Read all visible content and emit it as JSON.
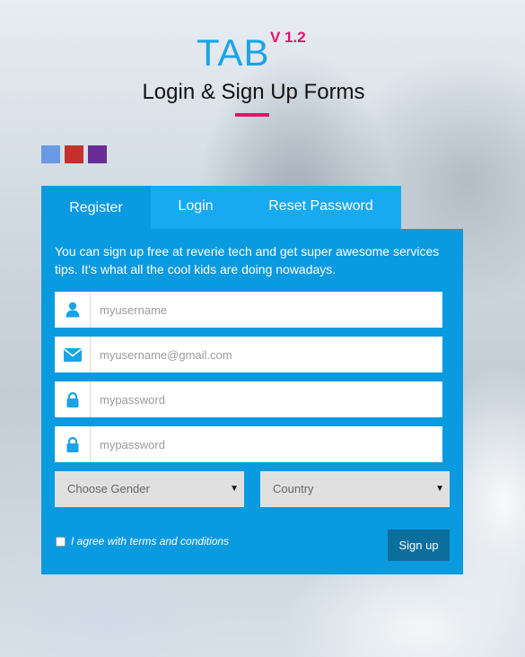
{
  "header": {
    "title": "TAB",
    "version": "V 1.2",
    "subtitle": "Login & Sign Up Forms"
  },
  "colors": {
    "accent": "#1aa3e8",
    "highlight": "#e6116b",
    "panel": "#0a9ae0",
    "tab_bar": "#17aaf0",
    "button": "#0b6e9c"
  },
  "swatches": [
    {
      "name": "blue",
      "color": "#6a9ae6"
    },
    {
      "name": "red",
      "color": "#c4302b"
    },
    {
      "name": "purple",
      "color": "#6a2c96"
    }
  ],
  "tabs": {
    "register": "Register",
    "login": "Login",
    "reset": "Reset Password",
    "active": "register"
  },
  "form": {
    "intro": "You can sign up free at reverie tech and get super awesome services tips. It's what all the cool kids are doing nowadays.",
    "username": {
      "placeholder": "myusername",
      "icon": "user-icon"
    },
    "email": {
      "placeholder": "myusername@gmail.com",
      "icon": "envelope-icon"
    },
    "password": {
      "placeholder": "mypassword",
      "icon": "lock-icon"
    },
    "confirm_password": {
      "placeholder": "mypassword",
      "icon": "lock-icon"
    },
    "gender": {
      "selected": "Choose Gender"
    },
    "country": {
      "selected": "Country"
    },
    "agree_label": "I agree with terms and conditions",
    "agree_checked": false,
    "submit_label": "Sign up"
  }
}
